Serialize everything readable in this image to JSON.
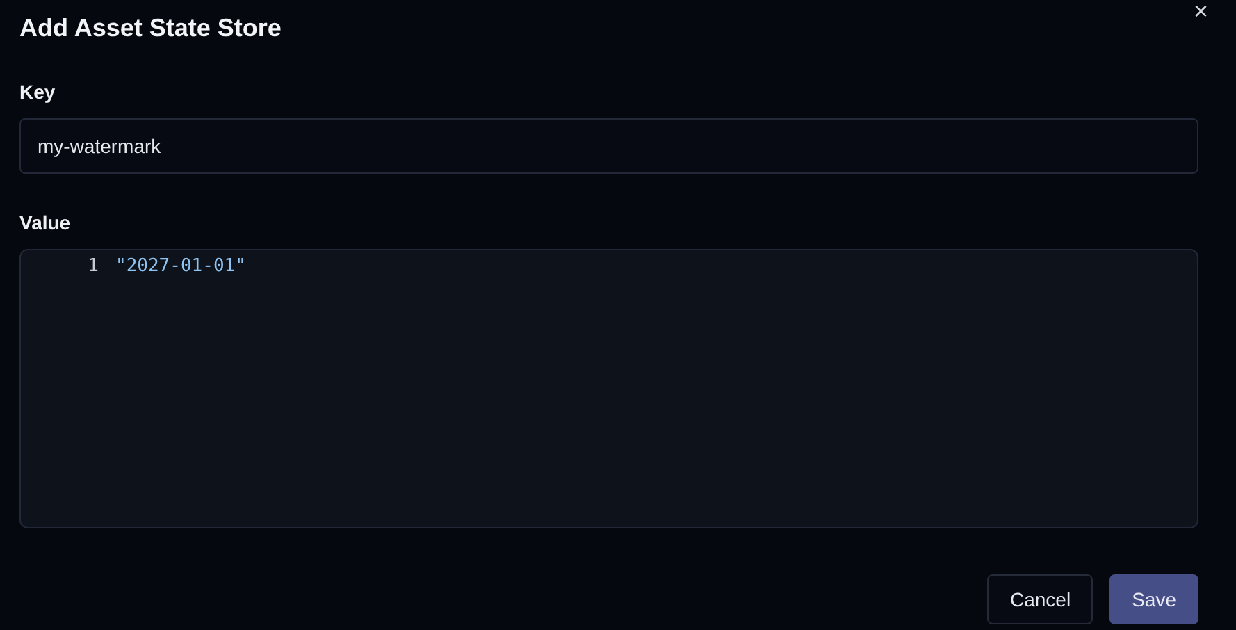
{
  "dialog": {
    "title": "Add Asset State Store",
    "close": "×"
  },
  "key": {
    "label": "Key",
    "value": "my-watermark"
  },
  "value": {
    "label": "Value",
    "lines": [
      {
        "number": "1",
        "text": "\"2027-01-01\""
      }
    ]
  },
  "buttons": [
    {
      "label": "Cancel",
      "kind": "secondary"
    },
    {
      "label": "Save",
      "kind": "primary"
    }
  ]
}
